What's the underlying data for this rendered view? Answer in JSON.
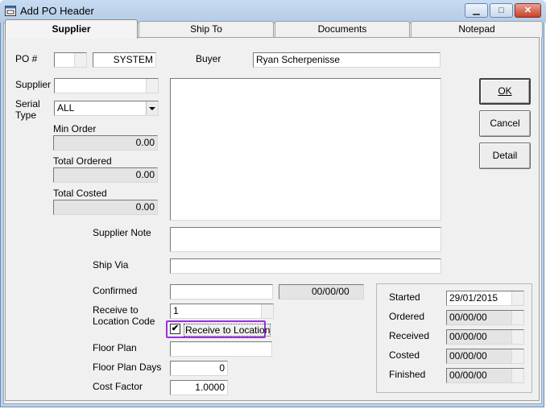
{
  "window": {
    "title": "Add PO Header"
  },
  "tabs": [
    "Supplier",
    "Ship To",
    "Documents",
    "Notepad"
  ],
  "labels": {
    "po_num": "PO #",
    "buyer": "Buyer",
    "supplier": "Supplier",
    "serial_type": "Serial\nType",
    "min_order": "Min Order",
    "total_ordered": "Total Ordered",
    "total_costed": "Total Costed",
    "supplier_note": "Supplier Note",
    "ship_via": "Ship Via",
    "confirmed": "Confirmed",
    "receive_to": "Receive to\nLocation Code",
    "floor_plan": "Floor Plan",
    "floor_plan_days": "Floor Plan Days",
    "cost_factor": "Cost Factor",
    "started": "Started",
    "ordered": "Ordered",
    "received": "Received",
    "costed": "Costed",
    "finished": "Finished"
  },
  "values": {
    "po_prefix": "",
    "po_system": "SYSTEM",
    "buyer": "Ryan Scherpenisse",
    "supplier": "",
    "serial_type": "ALL",
    "min_order": "0.00",
    "total_ordered": "0.00",
    "total_costed": "0.00",
    "supplier_note": "",
    "ship_via": "",
    "confirmed": "",
    "confirmed_date": "00/00/00",
    "receive_to_location": "1",
    "receive_to_location_checked": true,
    "floor_plan": "",
    "floor_plan_days": "0",
    "cost_factor": "1.0000",
    "started": "29/01/2015",
    "ordered": "00/00/00",
    "received": "00/00/00",
    "costed": "00/00/00",
    "finished": "00/00/00"
  },
  "checkbox": {
    "receive_to_location_label": "Receive to Location"
  },
  "buttons": {
    "ok": "OK",
    "cancel": "Cancel",
    "detail": "Detail"
  },
  "colors": {
    "highlight": "#9b30e0",
    "titlebar": "#b9d1ea",
    "close": "#c7412b"
  },
  "icons": {
    "title": "window-app-icon",
    "minimize": "minimize-icon",
    "maximize": "maximize-icon",
    "close": "close-icon",
    "dropdown": "chevron-down-icon",
    "check": "checkmark-icon"
  }
}
